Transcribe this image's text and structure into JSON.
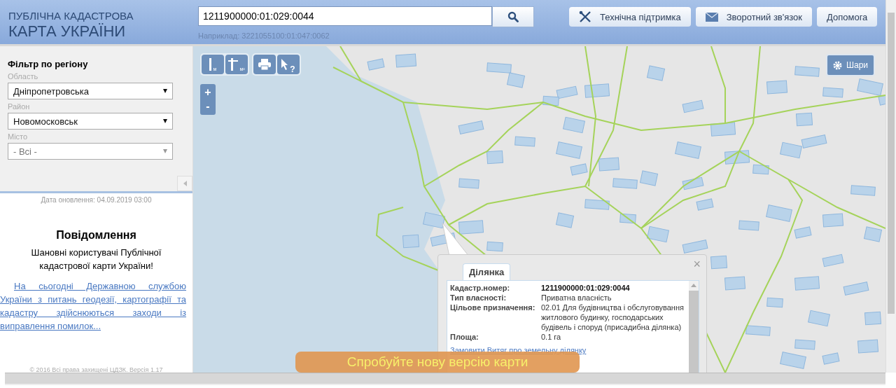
{
  "header": {
    "logo_line_1": "ПУБЛІЧНА КАДАСТРОВА",
    "logo_line_2": "КАРТА УКРАЇНИ",
    "search": {
      "value": "1211900000:01:029:0044",
      "hint": "Наприклад: 3221055100:01:047:0062"
    },
    "buttons": [
      {
        "kind": "support",
        "label": "Технічна підтримка"
      },
      {
        "kind": "feedback",
        "label": "Зворотний зв'язок"
      },
      {
        "kind": "help",
        "label": "Допомога"
      }
    ]
  },
  "sidebar": {
    "filter_title": "Фільтр по регіону",
    "filters": [
      {
        "label": "Область",
        "value": "Дніпропетровська",
        "disabled": false
      },
      {
        "label": "Район",
        "value": "Новомосковськ",
        "disabled": false
      },
      {
        "label": "Місто",
        "value": "- Всі -",
        "disabled": true
      }
    ],
    "updated": "Дата оновлення: 04.09.2019 03:00",
    "notice_title": "Повідомлення",
    "notice_text": "Шановні користувачі Публічної кадастрової карти України!",
    "notice_link": "На сьогодні Державною службою України з питань геодезії, картографії та кадастру здійснюються заходи із виправлення помилок...",
    "copyright": "© 2016 Всі права захищені ЦДЗК. Версія 1.17"
  },
  "map": {
    "tools": [
      {
        "kind": "distance",
        "label": "м"
      },
      {
        "kind": "area",
        "label": "м²"
      },
      {
        "kind": "print"
      },
      {
        "kind": "identify",
        "label": "?"
      }
    ],
    "zoom_in": "+",
    "zoom_out": "-",
    "layers_button": "Шари",
    "popup": {
      "tabs": [
        {
          "label": "Ділянка",
          "selected": true
        }
      ],
      "close": "×",
      "rows": [
        {
          "label": "Кадастр.номер:",
          "value": "1211900000:01:029:0044",
          "bold": true
        },
        {
          "label": "Тип власності:",
          "value": "Приватна власність",
          "bold": false
        },
        {
          "label": "Цільове призначення:",
          "value": "02.01 Для будівництва і обслуговування житлового будинку, господарських будівель і споруд (присадибна ділянка)",
          "bold": false
        },
        {
          "label": "Площа:",
          "value": "0.1 га",
          "bold": false
        }
      ],
      "link": "Замовити Витяг про земельну ділянку"
    },
    "banner": "Спробуйте нову версію карти"
  }
}
